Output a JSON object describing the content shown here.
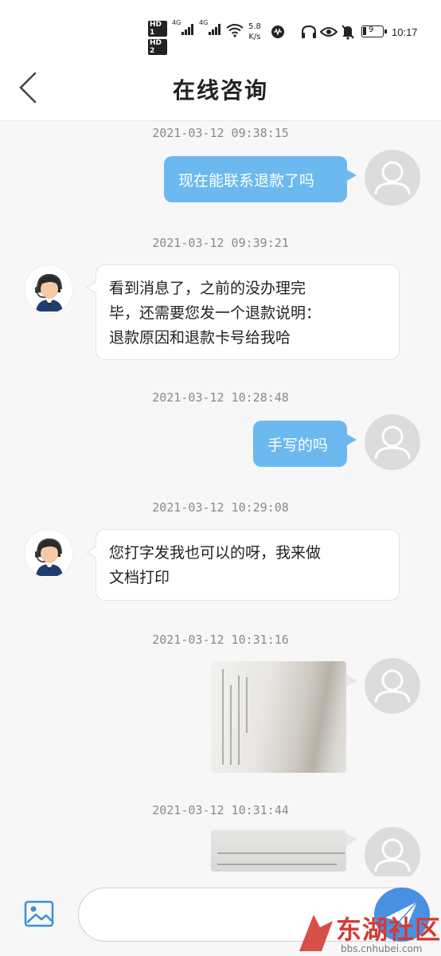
{
  "status_bar": {
    "hd1": "HD 1",
    "hd2": "HD 2",
    "sim1_gen": "4G",
    "sim2_gen": "4G",
    "speed_value": "5.8",
    "speed_unit": "K/s",
    "battery": "9",
    "time": "10:17"
  },
  "header": {
    "title": "在线咨询"
  },
  "messages": [
    {
      "timestamp": "2021-03-12 09:38:15",
      "from": "user",
      "text": "现在能联系退款了吗"
    },
    {
      "timestamp": "2021-03-12 09:39:21",
      "from": "agent",
      "lines": [
        "看到消息了，之前的没办理完",
        "毕，还需要您发一个退款说明：",
        "退款原因和退款卡号给我哈"
      ]
    },
    {
      "timestamp": "2021-03-12 10:28:48",
      "from": "user",
      "text": "手写的吗"
    },
    {
      "timestamp": "2021-03-12 10:29:08",
      "from": "agent",
      "lines": [
        "您打字发我也可以的呀，我来做",
        "文档打印"
      ]
    },
    {
      "timestamp": "2021-03-12 10:31:16",
      "from": "user",
      "type": "image"
    },
    {
      "timestamp": "2021-03-12 10:31:44",
      "from": "user",
      "type": "image"
    }
  ],
  "input": {
    "value": "",
    "placeholder": ""
  },
  "watermark": {
    "text": "东湖社区",
    "url": "bbs.cnhubei.com"
  },
  "colors": {
    "outgoing_bubble": "#6cb9f0",
    "incoming_bubble": "#ffffff",
    "send_button": "#4a90e2",
    "watermark": "#d23c35"
  }
}
